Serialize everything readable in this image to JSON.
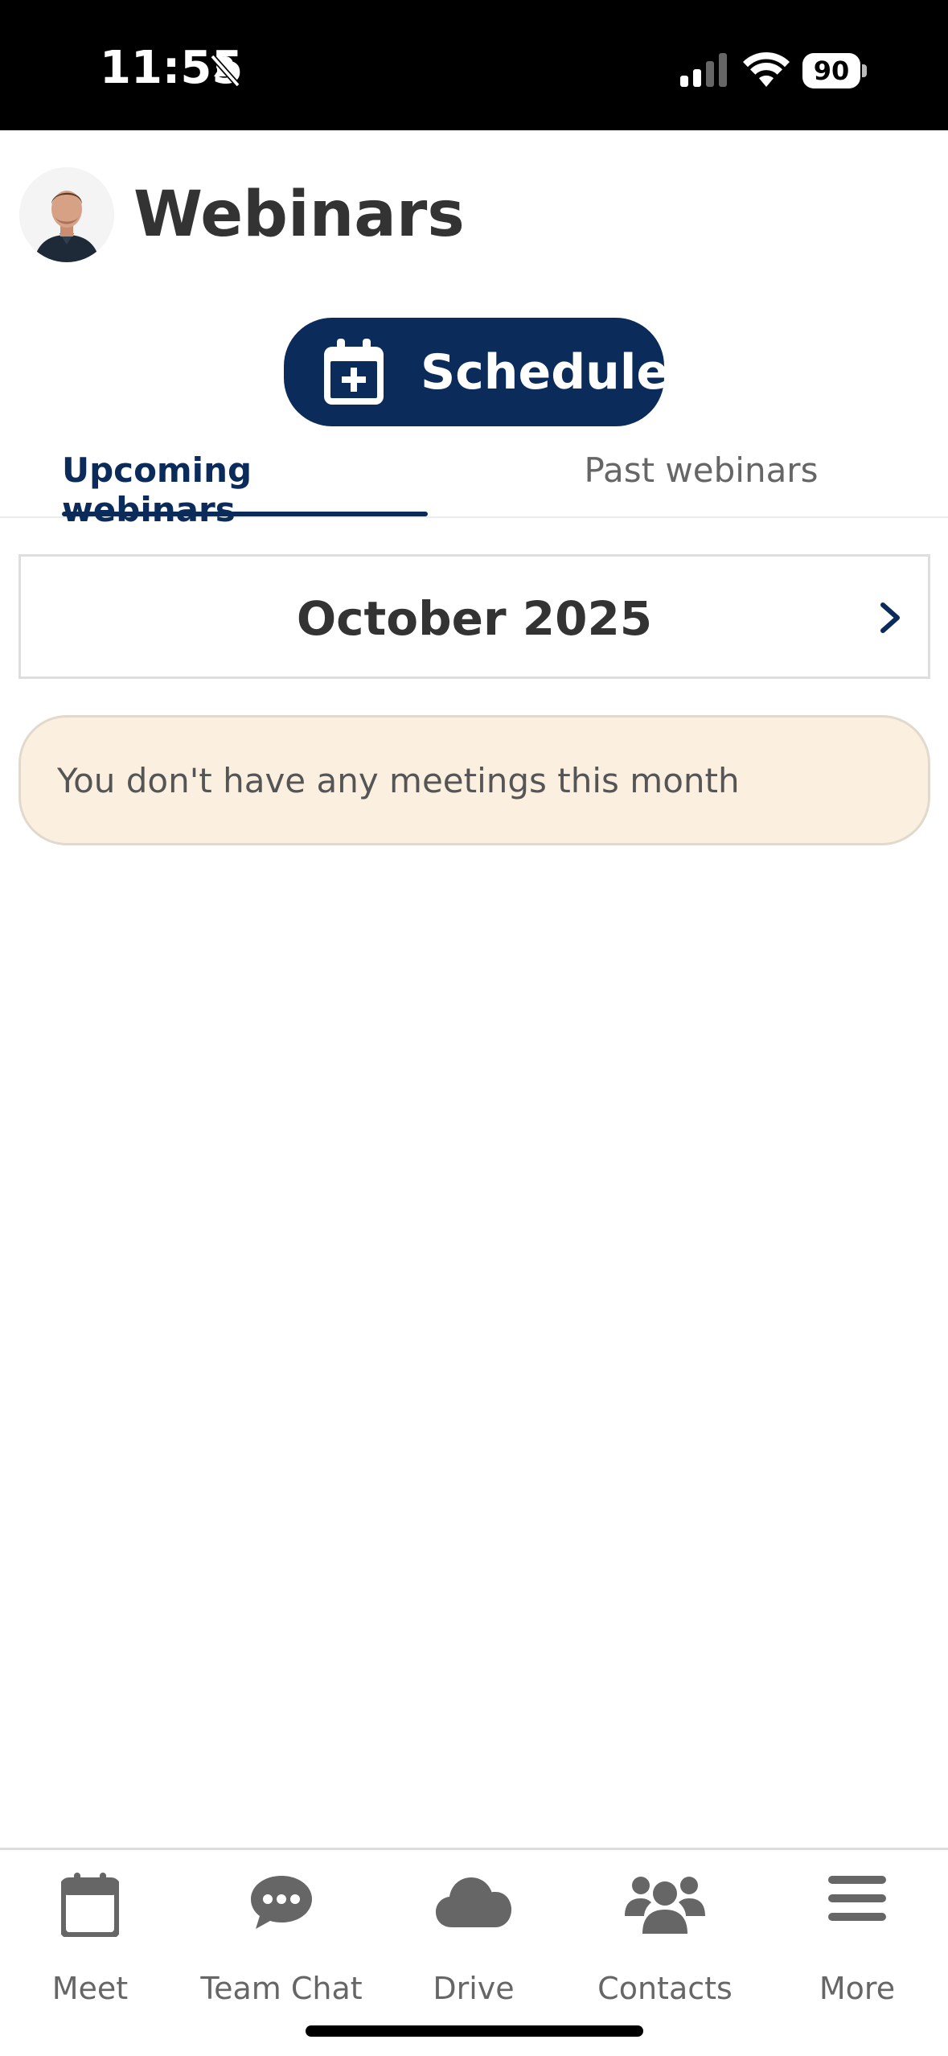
{
  "status_bar": {
    "time": "11:55",
    "battery": "90"
  },
  "header": {
    "title": "Webinars"
  },
  "schedule_button": {
    "label": "Schedule"
  },
  "tabs": [
    {
      "label": "Upcoming webinars",
      "active": true
    },
    {
      "label": "Past webinars",
      "active": false
    }
  ],
  "month_selector": {
    "label": "October 2025"
  },
  "empty_notice": {
    "text": "You don't have any meetings this month"
  },
  "bottom_nav": {
    "items": [
      {
        "label": "Meet",
        "icon": "calendar-icon"
      },
      {
        "label": "Team Chat",
        "icon": "chat-icon"
      },
      {
        "label": "Drive",
        "icon": "cloud-icon"
      },
      {
        "label": "Contacts",
        "icon": "people-icon"
      },
      {
        "label": "More",
        "icon": "menu-icon"
      }
    ]
  },
  "colors": {
    "brand_navy": "#0b2b5a",
    "notice_bg": "#fbf0e0"
  }
}
